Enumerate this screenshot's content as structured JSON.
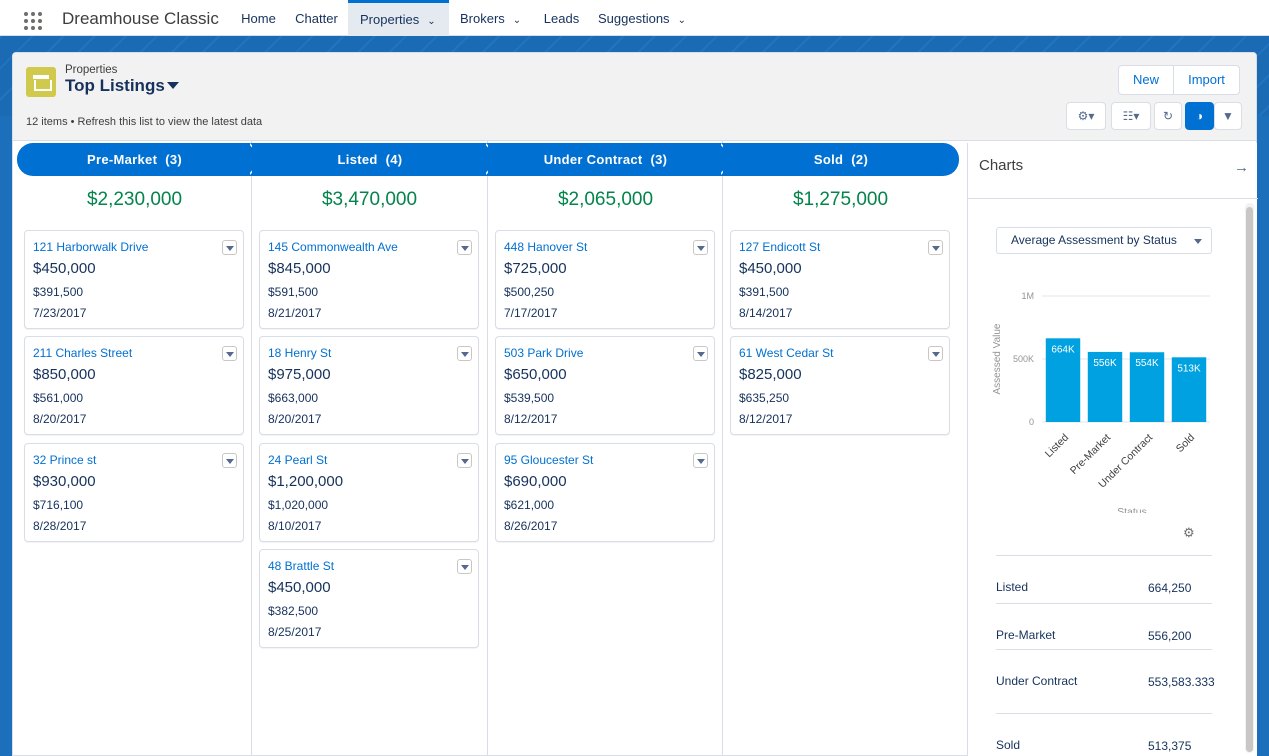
{
  "nav": {
    "app_name": "Dreamhouse Classic",
    "items": [
      {
        "label": "Home"
      },
      {
        "label": "Chatter"
      },
      {
        "label": "Properties",
        "active": true
      },
      {
        "label": "Brokers"
      },
      {
        "label": "Leads"
      },
      {
        "label": "Suggestions"
      }
    ]
  },
  "header": {
    "object_label": "Properties",
    "list_name": "Top Listings",
    "summary": "12 items • Refresh this list to view the latest data",
    "new_label": "New",
    "import_label": "Import"
  },
  "kanban": {
    "columns": [
      {
        "stage": "Pre-Market",
        "count": "(3)",
        "total": "$2,230,000",
        "cards": [
          {
            "address": "121 Harborwalk Drive",
            "price": "$450,000",
            "assessed": "$391,500",
            "date": "7/23/2017"
          },
          {
            "address": "211 Charles Street",
            "price": "$850,000",
            "assessed": "$561,000",
            "date": "8/20/2017"
          },
          {
            "address": "32 Prince st",
            "price": "$930,000",
            "assessed": "$716,100",
            "date": "8/28/2017"
          }
        ]
      },
      {
        "stage": "Listed",
        "count": "(4)",
        "total": "$3,470,000",
        "cards": [
          {
            "address": "145 Commonwealth Ave",
            "price": "$845,000",
            "assessed": "$591,500",
            "date": "8/21/2017"
          },
          {
            "address": "18 Henry St",
            "price": "$975,000",
            "assessed": "$663,000",
            "date": "8/20/2017"
          },
          {
            "address": "24 Pearl St",
            "price": "$1,200,000",
            "assessed": "$1,020,000",
            "date": "8/10/2017"
          },
          {
            "address": "48 Brattle St",
            "price": "$450,000",
            "assessed": "$382,500",
            "date": "8/25/2017"
          }
        ]
      },
      {
        "stage": "Under Contract",
        "count": "(3)",
        "total": "$2,065,000",
        "cards": [
          {
            "address": "448 Hanover St",
            "price": "$725,000",
            "assessed": "$500,250",
            "date": "7/17/2017"
          },
          {
            "address": "503 Park Drive",
            "price": "$650,000",
            "assessed": "$539,500",
            "date": "8/12/2017"
          },
          {
            "address": "95 Gloucester St",
            "price": "$690,000",
            "assessed": "$621,000",
            "date": "8/26/2017"
          }
        ]
      },
      {
        "stage": "Sold",
        "count": "(2)",
        "total": "$1,275,000",
        "cards": [
          {
            "address": "127 Endicott St",
            "price": "$450,000",
            "assessed": "$391,500",
            "date": "8/14/2017"
          },
          {
            "address": "61 West Cedar St",
            "price": "$825,000",
            "assessed": "$635,250",
            "date": "8/12/2017"
          }
        ]
      }
    ]
  },
  "panel": {
    "title": "Charts",
    "report_select": "Average Assessment by Status",
    "table": [
      {
        "status": "Listed",
        "value": "664,250"
      },
      {
        "status": "Pre-Market",
        "value": "556,200"
      },
      {
        "status": "Under Contract",
        "value": "553,583.333"
      },
      {
        "status": "Sold",
        "value": "513,375"
      }
    ]
  },
  "colors": {
    "brand": "#0070d2",
    "total_green": "#04844b",
    "bar": "#00a1e0",
    "nav_band": "#1c6fba"
  },
  "chart_data": {
    "type": "bar",
    "categories": [
      "Listed",
      "Pre-Market",
      "Under Contract",
      "Sold"
    ],
    "values": [
      664250,
      556200,
      553583.333,
      513375
    ],
    "data_labels": [
      "664K",
      "556K",
      "554K",
      "513K"
    ],
    "ylabel": "Assessed Value",
    "xlabel": "Status",
    "ylim": [
      0,
      1000000
    ],
    "yticks": [
      "0",
      "500K",
      "1M"
    ],
    "ytick_values": [
      0,
      500000,
      1000000
    ],
    "grid": true
  }
}
